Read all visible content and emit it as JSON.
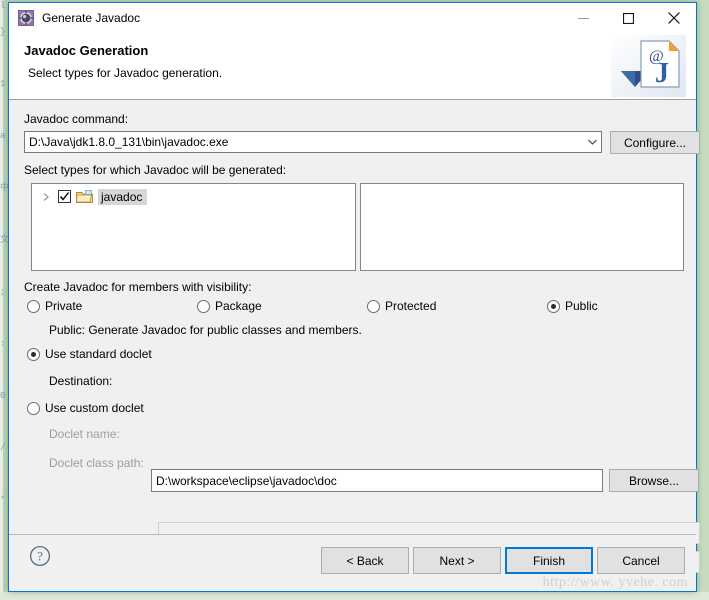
{
  "window": {
    "title": "Generate Javadoc",
    "icon": "javadoc-wizard-icon",
    "minimize_label": "Minimize",
    "maximize_label": "Maximize",
    "close_label": "Close"
  },
  "header": {
    "title": "Javadoc Generation",
    "description": "Select types for Javadoc generation.",
    "graphic": "javadoc-page-icon"
  },
  "command": {
    "label": "Javadoc command:",
    "value": "D:\\Java\\jdk1.8.0_131\\bin\\javadoc.exe",
    "configure_label": "Configure..."
  },
  "types": {
    "label": "Select types for which Javadoc will be generated:",
    "tree": [
      {
        "label": "javadoc",
        "checked": true,
        "expanded": false,
        "selected": true,
        "icon": "java-project-folder-icon"
      }
    ],
    "right_pane_items": []
  },
  "visibility": {
    "label": "Create Javadoc for members with visibility:",
    "options": [
      {
        "label": "Private",
        "selected": false
      },
      {
        "label": "Package",
        "selected": false
      },
      {
        "label": "Protected",
        "selected": false
      },
      {
        "label": "Public",
        "selected": true
      }
    ],
    "description": "Public: Generate Javadoc for public classes and members."
  },
  "doclet": {
    "standard_label": "Use standard doclet",
    "standard_selected": true,
    "destination_label": "Destination:",
    "destination_value": "D:\\workspace\\eclipse\\javadoc\\doc",
    "browse_label": "Browse...",
    "custom_label": "Use custom doclet",
    "custom_selected": false,
    "doclet_name_label": "Doclet name:",
    "doclet_name_value": "",
    "doclet_classpath_label": "Doclet class path:",
    "doclet_classpath_value": ""
  },
  "footer": {
    "help_label": "?",
    "back_label": "< Back",
    "next_label": "Next >",
    "finish_label": "Finish",
    "cancel_label": "Cancel",
    "default_button": "Finish"
  },
  "watermark": "http://www. yvehe. com",
  "background": {
    "code_lines": "l\n\n}\n\n\n\n1\n\n\n\na\n\n\n\n中\n\n\n\n文\n\n\n\n;\n\n\n\n:\n\n\n\n0\n\n\n\n/\n\n\n\n*"
  },
  "colors": {
    "accent": "#0078d7",
    "dialog_bg": "#f0f0f0",
    "header_bg": "#ffffff",
    "desktop_bg": "#c6dcbe",
    "selection": "#d6d6d6"
  }
}
